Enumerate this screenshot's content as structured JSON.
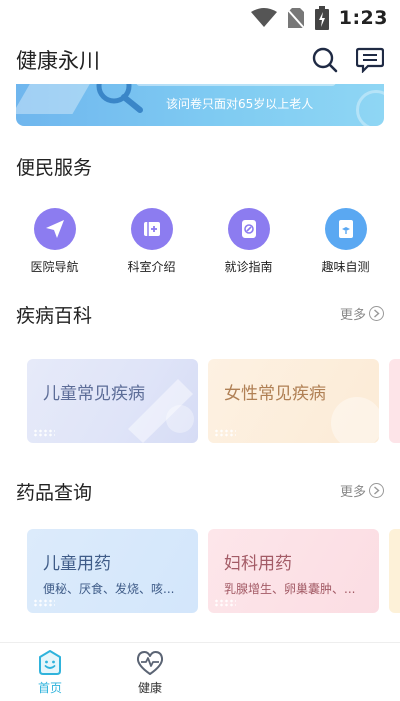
{
  "status_bar": {
    "time": "1:23"
  },
  "header": {
    "title": "健康永川",
    "search_icon": "search-icon",
    "message_icon": "message-icon"
  },
  "banner": {
    "subtitle": "该问卷只面对65岁以上老人"
  },
  "convenience": {
    "title": "便民服务",
    "items": [
      {
        "label": "医院导航",
        "icon": "navigation-icon",
        "color": "#8c7cf0"
      },
      {
        "label": "科室介绍",
        "icon": "department-icon",
        "color": "#8c7cf0"
      },
      {
        "label": "就诊指南",
        "icon": "guide-icon",
        "color": "#8c7cf0"
      },
      {
        "label": "趣味自测",
        "icon": "self-test-icon",
        "color": "#5aa8f2"
      }
    ]
  },
  "disease": {
    "title": "疾病百科",
    "more": "更多",
    "cards": [
      {
        "title": "儿童常见疾病"
      },
      {
        "title": "女性常见疾病"
      }
    ]
  },
  "drugs": {
    "title": "药品查询",
    "more": "更多",
    "cards": [
      {
        "title": "儿童用药",
        "desc": "便秘、厌食、发烧、咳..."
      },
      {
        "title": "妇科用药",
        "desc": "乳腺增生、卵巢囊肿、..."
      }
    ]
  },
  "bottom_nav": {
    "items": [
      {
        "label": "首页",
        "active": true
      },
      {
        "label": "健康",
        "active": false
      }
    ]
  }
}
